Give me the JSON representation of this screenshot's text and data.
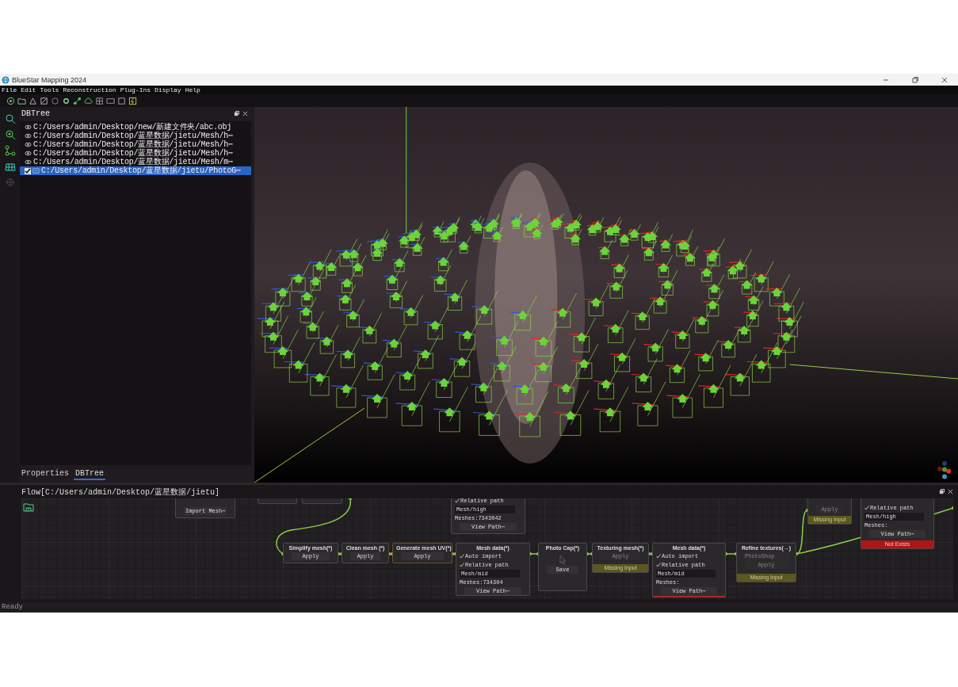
{
  "window": {
    "title": "BlueStar Mapping 2024"
  },
  "menu": [
    "File",
    "Edit",
    "Tools",
    "Reconstruction",
    "Plug-Ins",
    "Display",
    "Help"
  ],
  "dbtree": {
    "title": "DBTree",
    "items": [
      {
        "kind": "mesh",
        "label": "C:/Users/admin/Desktop/new/新建文件夹/abc.obj",
        "selected": false
      },
      {
        "kind": "mesh",
        "label": "C:/Users/admin/Desktop/蓝星数据/jietu/Mesh/h⋯",
        "selected": false
      },
      {
        "kind": "mesh",
        "label": "C:/Users/admin/Desktop/蓝星数据/jietu/Mesh/h⋯",
        "selected": false
      },
      {
        "kind": "mesh",
        "label": "C:/Users/admin/Desktop/蓝星数据/jietu/Mesh/h⋯",
        "selected": false
      },
      {
        "kind": "mesh",
        "label": "C:/Users/admin/Desktop/蓝星数据/jietu/Mesh/m⋯",
        "selected": false
      },
      {
        "kind": "folder",
        "label": "C:/Users/admin/Desktop/蓝星数据/jietu/PhotoG⋯",
        "checked": true,
        "selected": true
      }
    ]
  },
  "bottom_tabs": [
    {
      "label": "Properties",
      "selected": false
    },
    {
      "label": "DBTree",
      "selected": true
    }
  ],
  "flow": {
    "title": "Flow[C:/Users/admin/Desktop/蓝星数据/jietu]",
    "nodes": [
      {
        "active": false,
        "invalid": false,
        "rows": [
          {
            "kind": "button",
            "label": "Import Mesh⋯",
            "disabled": false
          }
        ]
      },
      {
        "active": false,
        "invalid": false
      },
      {
        "active": false,
        "invalid": false
      },
      {
        "active": false,
        "invalid": false,
        "rows": [
          {
            "kind": "check",
            "label": "Relative path",
            "checked": true
          },
          {
            "kind": "field",
            "value": "Mesh/high"
          },
          {
            "kind": "text",
            "label": "Meshes:7343042"
          },
          {
            "kind": "button",
            "label": "View Path⋯",
            "disabled": false
          }
        ]
      },
      {
        "active": false,
        "invalid": false,
        "title": "Simplify mesh(*)",
        "rows": [
          {
            "kind": "button",
            "label": "Apply",
            "disabled": false
          }
        ]
      },
      {
        "active": false,
        "invalid": false,
        "title": "Clean mesh (*)",
        "rows": [
          {
            "kind": "button",
            "label": "Apply",
            "disabled": false
          }
        ]
      },
      {
        "active": true,
        "invalid": false,
        "title": "Generate mesh UV(*)",
        "rows": [
          {
            "kind": "button",
            "label": "Apply",
            "disabled": false
          }
        ]
      },
      {
        "active": false,
        "invalid": false,
        "title": "Mesh data(*)",
        "rows": [
          {
            "kind": "check",
            "label": "Auto import",
            "checked": true
          },
          {
            "kind": "check",
            "label": "Relative path",
            "checked": true
          },
          {
            "kind": "field",
            "value": "Mesh/mid"
          },
          {
            "kind": "text",
            "label": "Meshes:734304"
          },
          {
            "kind": "button",
            "label": "View Path⋯",
            "disabled": false
          }
        ]
      },
      {
        "active": false,
        "invalid": false,
        "title": "Photo Cap(*)",
        "rows": [
          {
            "kind": "preview"
          },
          {
            "kind": "button",
            "label": "Save",
            "disabled": false
          }
        ]
      },
      {
        "active": false,
        "invalid": false,
        "title": "Texturing mesh(*)",
        "rows": [
          {
            "kind": "button",
            "label": "Apply",
            "disabled": true
          }
        ],
        "footer": {
          "kind": "warning",
          "label": "Missing Input"
        }
      },
      {
        "active": false,
        "invalid": true,
        "title": "Mesh data(*)",
        "rows": [
          {
            "kind": "check",
            "label": "Auto import",
            "checked": true
          },
          {
            "kind": "check",
            "label": "Relative path",
            "checked": true
          },
          {
            "kind": "field",
            "value": "Mesh/mid"
          },
          {
            "kind": "text",
            "label": "Meshes:"
          },
          {
            "kind": "button",
            "label": "View Path⋯",
            "disabled": false
          }
        ]
      },
      {
        "active": false,
        "invalid": false,
        "title": "Refine textures(→)",
        "rows": [
          {
            "kind": "dropdown",
            "value": "PhotoShop",
            "disabled": true
          },
          {
            "kind": "button",
            "label": "Apply",
            "disabled": true
          }
        ],
        "footer": {
          "kind": "warning",
          "label": "Missing Input"
        }
      },
      {
        "active": false,
        "invalid": false,
        "rows": [
          {
            "kind": "button",
            "label": "Apply",
            "disabled": true
          }
        ],
        "footer": {
          "kind": "warning",
          "label": "Missing Input"
        }
      },
      {
        "active": false,
        "invalid": false,
        "rows": [
          {
            "kind": "check",
            "label": "Relative path",
            "checked": true
          },
          {
            "kind": "field",
            "value": "Mesh/high"
          },
          {
            "kind": "text",
            "label": "Meshes:"
          },
          {
            "kind": "button",
            "label": "View Path⋯",
            "disabled": false
          }
        ],
        "footer": {
          "kind": "error",
          "label": "Not Exists"
        }
      }
    ]
  },
  "status_bar": "Ready"
}
